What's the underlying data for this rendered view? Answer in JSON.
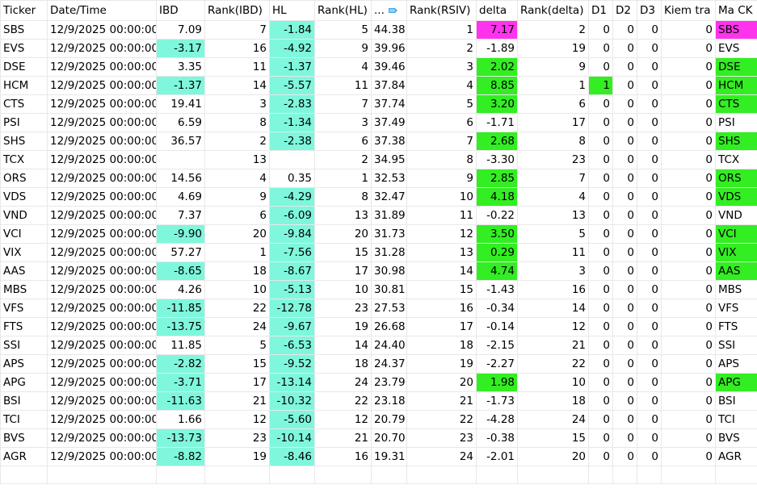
{
  "columns": [
    {
      "key": "ticker",
      "label": "Ticker",
      "align": "l"
    },
    {
      "key": "date",
      "label": "Date/Time",
      "align": "l"
    },
    {
      "key": "ibd",
      "label": "IBD",
      "align": "r"
    },
    {
      "key": "rank_ibd",
      "label": "Rank(IBD)",
      "align": "r"
    },
    {
      "key": "hl",
      "label": "HL",
      "align": "r"
    },
    {
      "key": "rank_hl",
      "label": "Rank(HL)",
      "align": "l"
    },
    {
      "key": "rsiv",
      "label": "...",
      "align": "l",
      "icon": "sort-descending-icon"
    },
    {
      "key": "rank_rsiv",
      "label": "Rank(RSIV)",
      "align": "l"
    },
    {
      "key": "delta",
      "label": "delta",
      "align": "l"
    },
    {
      "key": "rank_delta",
      "label": "Rank(delta)",
      "align": "l"
    },
    {
      "key": "d1",
      "label": "D1",
      "align": "l"
    },
    {
      "key": "d2",
      "label": "D2",
      "align": "l"
    },
    {
      "key": "d3",
      "label": "D3",
      "align": "l"
    },
    {
      "key": "kiem",
      "label": "Kiem tra",
      "align": "l"
    },
    {
      "key": "mack",
      "label": "Ma CK",
      "align": "l"
    }
  ],
  "colors": {
    "cyan": "#7ff7dc",
    "green": "#33ee22",
    "magenta": "#ff33ee"
  },
  "rows": [
    {
      "ticker": "SBS",
      "date": "12/9/2025 00:00:00",
      "ibd": "7.09",
      "rank_ibd": "7",
      "hl": "-1.84",
      "rank_hl": "5",
      "rsiv": "44.38",
      "rank_rsiv": "1",
      "delta": "7.17",
      "rank_delta": "2",
      "d1": "0",
      "d2": "0",
      "d3": "0",
      "kiem": "0",
      "mack": "SBS",
      "ibd_c": "",
      "hl_c": "cyan",
      "delta_c": "magenta",
      "d1_c": "",
      "mack_c": "magenta"
    },
    {
      "ticker": "EVS",
      "date": "12/9/2025 00:00:00",
      "ibd": "-3.17",
      "rank_ibd": "16",
      "hl": "-4.92",
      "rank_hl": "9",
      "rsiv": "39.96",
      "rank_rsiv": "2",
      "delta": "-1.89",
      "rank_delta": "19",
      "d1": "0",
      "d2": "0",
      "d3": "0",
      "kiem": "0",
      "mack": "EVS",
      "ibd_c": "cyan",
      "hl_c": "cyan",
      "delta_c": "",
      "d1_c": "",
      "mack_c": ""
    },
    {
      "ticker": "DSE",
      "date": "12/9/2025 00:00:00",
      "ibd": "3.35",
      "rank_ibd": "11",
      "hl": "-1.37",
      "rank_hl": "4",
      "rsiv": "39.46",
      "rank_rsiv": "3",
      "delta": "2.02",
      "rank_delta": "9",
      "d1": "0",
      "d2": "0",
      "d3": "0",
      "kiem": "0",
      "mack": "DSE",
      "ibd_c": "",
      "hl_c": "cyan",
      "delta_c": "green",
      "d1_c": "",
      "mack_c": "green"
    },
    {
      "ticker": "HCM",
      "date": "12/9/2025 00:00:00",
      "ibd": "-1.37",
      "rank_ibd": "14",
      "hl": "-5.57",
      "rank_hl": "11",
      "rsiv": "37.84",
      "rank_rsiv": "4",
      "delta": "8.85",
      "rank_delta": "1",
      "d1": "1",
      "d2": "0",
      "d3": "0",
      "kiem": "0",
      "mack": "HCM",
      "ibd_c": "cyan",
      "hl_c": "cyan",
      "delta_c": "green",
      "d1_c": "green",
      "mack_c": "green"
    },
    {
      "ticker": "CTS",
      "date": "12/9/2025 00:00:00",
      "ibd": "19.41",
      "rank_ibd": "3",
      "hl": "-2.83",
      "rank_hl": "7",
      "rsiv": "37.74",
      "rank_rsiv": "5",
      "delta": "3.20",
      "rank_delta": "6",
      "d1": "0",
      "d2": "0",
      "d3": "0",
      "kiem": "0",
      "mack": "CTS",
      "ibd_c": "",
      "hl_c": "cyan",
      "delta_c": "green",
      "d1_c": "",
      "mack_c": "green"
    },
    {
      "ticker": "PSI",
      "date": "12/9/2025 00:00:00",
      "ibd": "6.59",
      "rank_ibd": "8",
      "hl": "-1.34",
      "rank_hl": "3",
      "rsiv": "37.49",
      "rank_rsiv": "6",
      "delta": "-1.71",
      "rank_delta": "17",
      "d1": "0",
      "d2": "0",
      "d3": "0",
      "kiem": "0",
      "mack": "PSI",
      "ibd_c": "",
      "hl_c": "cyan",
      "delta_c": "",
      "d1_c": "",
      "mack_c": ""
    },
    {
      "ticker": "SHS",
      "date": "12/9/2025 00:00:00",
      "ibd": "36.57",
      "rank_ibd": "2",
      "hl": "-2.38",
      "rank_hl": "6",
      "rsiv": "37.38",
      "rank_rsiv": "7",
      "delta": "2.68",
      "rank_delta": "8",
      "d1": "0",
      "d2": "0",
      "d3": "0",
      "kiem": "0",
      "mack": "SHS",
      "ibd_c": "",
      "hl_c": "cyan",
      "delta_c": "green",
      "d1_c": "",
      "mack_c": "green"
    },
    {
      "ticker": "TCX",
      "date": "12/9/2025 00:00:00",
      "ibd": "",
      "rank_ibd": "13",
      "hl": "",
      "rank_hl": "2",
      "rsiv": "34.95",
      "rank_rsiv": "8",
      "delta": "-3.30",
      "rank_delta": "23",
      "d1": "0",
      "d2": "0",
      "d3": "0",
      "kiem": "0",
      "mack": "TCX",
      "ibd_c": "",
      "hl_c": "",
      "delta_c": "",
      "d1_c": "",
      "mack_c": ""
    },
    {
      "ticker": "ORS",
      "date": "12/9/2025 00:00:00",
      "ibd": "14.56",
      "rank_ibd": "4",
      "hl": "0.35",
      "rank_hl": "1",
      "rsiv": "32.53",
      "rank_rsiv": "9",
      "delta": "2.85",
      "rank_delta": "7",
      "d1": "0",
      "d2": "0",
      "d3": "0",
      "kiem": "0",
      "mack": "ORS",
      "ibd_c": "",
      "hl_c": "",
      "delta_c": "green",
      "d1_c": "",
      "mack_c": "green"
    },
    {
      "ticker": "VDS",
      "date": "12/9/2025 00:00:00",
      "ibd": "4.69",
      "rank_ibd": "9",
      "hl": "-4.29",
      "rank_hl": "8",
      "rsiv": "32.47",
      "rank_rsiv": "10",
      "delta": "4.18",
      "rank_delta": "4",
      "d1": "0",
      "d2": "0",
      "d3": "0",
      "kiem": "0",
      "mack": "VDS",
      "ibd_c": "",
      "hl_c": "cyan",
      "delta_c": "green",
      "d1_c": "",
      "mack_c": "green"
    },
    {
      "ticker": "VND",
      "date": "12/9/2025 00:00:00",
      "ibd": "7.37",
      "rank_ibd": "6",
      "hl": "-6.09",
      "rank_hl": "13",
      "rsiv": "31.89",
      "rank_rsiv": "11",
      "delta": "-0.22",
      "rank_delta": "13",
      "d1": "0",
      "d2": "0",
      "d3": "0",
      "kiem": "0",
      "mack": "VND",
      "ibd_c": "",
      "hl_c": "cyan",
      "delta_c": "",
      "d1_c": "",
      "mack_c": ""
    },
    {
      "ticker": "VCI",
      "date": "12/9/2025 00:00:00",
      "ibd": "-9.90",
      "rank_ibd": "20",
      "hl": "-9.84",
      "rank_hl": "20",
      "rsiv": "31.73",
      "rank_rsiv": "12",
      "delta": "3.50",
      "rank_delta": "5",
      "d1": "0",
      "d2": "0",
      "d3": "0",
      "kiem": "0",
      "mack": "VCI",
      "ibd_c": "cyan",
      "hl_c": "cyan",
      "delta_c": "green",
      "d1_c": "",
      "mack_c": "green"
    },
    {
      "ticker": "VIX",
      "date": "12/9/2025 00:00:00",
      "ibd": "57.27",
      "rank_ibd": "1",
      "hl": "-7.56",
      "rank_hl": "15",
      "rsiv": "31.28",
      "rank_rsiv": "13",
      "delta": "0.29",
      "rank_delta": "11",
      "d1": "0",
      "d2": "0",
      "d3": "0",
      "kiem": "0",
      "mack": "VIX",
      "ibd_c": "",
      "hl_c": "cyan",
      "delta_c": "green",
      "d1_c": "",
      "mack_c": "green"
    },
    {
      "ticker": "AAS",
      "date": "12/9/2025 00:00:00",
      "ibd": "-8.65",
      "rank_ibd": "18",
      "hl": "-8.67",
      "rank_hl": "17",
      "rsiv": "30.98",
      "rank_rsiv": "14",
      "delta": "4.74",
      "rank_delta": "3",
      "d1": "0",
      "d2": "0",
      "d3": "0",
      "kiem": "0",
      "mack": "AAS",
      "ibd_c": "cyan",
      "hl_c": "cyan",
      "delta_c": "green",
      "d1_c": "",
      "mack_c": "green"
    },
    {
      "ticker": "MBS",
      "date": "12/9/2025 00:00:00",
      "ibd": "4.26",
      "rank_ibd": "10",
      "hl": "-5.13",
      "rank_hl": "10",
      "rsiv": "30.81",
      "rank_rsiv": "15",
      "delta": "-1.43",
      "rank_delta": "16",
      "d1": "0",
      "d2": "0",
      "d3": "0",
      "kiem": "0",
      "mack": "MBS",
      "ibd_c": "",
      "hl_c": "cyan",
      "delta_c": "",
      "d1_c": "",
      "mack_c": ""
    },
    {
      "ticker": "VFS",
      "date": "12/9/2025 00:00:00",
      "ibd": "-11.85",
      "rank_ibd": "22",
      "hl": "-12.78",
      "rank_hl": "23",
      "rsiv": "27.53",
      "rank_rsiv": "16",
      "delta": "-0.34",
      "rank_delta": "14",
      "d1": "0",
      "d2": "0",
      "d3": "0",
      "kiem": "0",
      "mack": "VFS",
      "ibd_c": "cyan",
      "hl_c": "cyan",
      "delta_c": "",
      "d1_c": "",
      "mack_c": ""
    },
    {
      "ticker": "FTS",
      "date": "12/9/2025 00:00:00",
      "ibd": "-13.75",
      "rank_ibd": "24",
      "hl": "-9.67",
      "rank_hl": "19",
      "rsiv": "26.68",
      "rank_rsiv": "17",
      "delta": "-0.14",
      "rank_delta": "12",
      "d1": "0",
      "d2": "0",
      "d3": "0",
      "kiem": "0",
      "mack": "FTS",
      "ibd_c": "cyan",
      "hl_c": "cyan",
      "delta_c": "",
      "d1_c": "",
      "mack_c": ""
    },
    {
      "ticker": "SSI",
      "date": "12/9/2025 00:00:00",
      "ibd": "11.85",
      "rank_ibd": "5",
      "hl": "-6.53",
      "rank_hl": "14",
      "rsiv": "24.40",
      "rank_rsiv": "18",
      "delta": "-2.15",
      "rank_delta": "21",
      "d1": "0",
      "d2": "0",
      "d3": "0",
      "kiem": "0",
      "mack": "SSI",
      "ibd_c": "",
      "hl_c": "cyan",
      "delta_c": "",
      "d1_c": "",
      "mack_c": ""
    },
    {
      "ticker": "APS",
      "date": "12/9/2025 00:00:00",
      "ibd": "-2.82",
      "rank_ibd": "15",
      "hl": "-9.52",
      "rank_hl": "18",
      "rsiv": "24.37",
      "rank_rsiv": "19",
      "delta": "-2.27",
      "rank_delta": "22",
      "d1": "0",
      "d2": "0",
      "d3": "0",
      "kiem": "0",
      "mack": "APS",
      "ibd_c": "cyan",
      "hl_c": "cyan",
      "delta_c": "",
      "d1_c": "",
      "mack_c": ""
    },
    {
      "ticker": "APG",
      "date": "12/9/2025 00:00:00",
      "ibd": "-3.71",
      "rank_ibd": "17",
      "hl": "-13.14",
      "rank_hl": "24",
      "rsiv": "23.79",
      "rank_rsiv": "20",
      "delta": "1.98",
      "rank_delta": "10",
      "d1": "0",
      "d2": "0",
      "d3": "0",
      "kiem": "0",
      "mack": "APG",
      "ibd_c": "cyan",
      "hl_c": "cyan",
      "delta_c": "green",
      "d1_c": "",
      "mack_c": "green"
    },
    {
      "ticker": "BSI",
      "date": "12/9/2025 00:00:00",
      "ibd": "-11.63",
      "rank_ibd": "21",
      "hl": "-10.32",
      "rank_hl": "22",
      "rsiv": "23.18",
      "rank_rsiv": "21",
      "delta": "-1.73",
      "rank_delta": "18",
      "d1": "0",
      "d2": "0",
      "d3": "0",
      "kiem": "0",
      "mack": "BSI",
      "ibd_c": "cyan",
      "hl_c": "cyan",
      "delta_c": "",
      "d1_c": "",
      "mack_c": ""
    },
    {
      "ticker": "TCI",
      "date": "12/9/2025 00:00:00",
      "ibd": "1.66",
      "rank_ibd": "12",
      "hl": "-5.60",
      "rank_hl": "12",
      "rsiv": "20.79",
      "rank_rsiv": "22",
      "delta": "-4.28",
      "rank_delta": "24",
      "d1": "0",
      "d2": "0",
      "d3": "0",
      "kiem": "0",
      "mack": "TCI",
      "ibd_c": "",
      "hl_c": "cyan",
      "delta_c": "",
      "d1_c": "",
      "mack_c": ""
    },
    {
      "ticker": "BVS",
      "date": "12/9/2025 00:00:00",
      "ibd": "-13.73",
      "rank_ibd": "23",
      "hl": "-10.14",
      "rank_hl": "21",
      "rsiv": "20.70",
      "rank_rsiv": "23",
      "delta": "-0.38",
      "rank_delta": "15",
      "d1": "0",
      "d2": "0",
      "d3": "0",
      "kiem": "0",
      "mack": "BVS",
      "ibd_c": "cyan",
      "hl_c": "cyan",
      "delta_c": "",
      "d1_c": "",
      "mack_c": ""
    },
    {
      "ticker": "AGR",
      "date": "12/9/2025 00:00:00",
      "ibd": "-8.82",
      "rank_ibd": "19",
      "hl": "-8.46",
      "rank_hl": "16",
      "rsiv": "19.31",
      "rank_rsiv": "24",
      "delta": "-2.01",
      "rank_delta": "20",
      "d1": "0",
      "d2": "0",
      "d3": "0",
      "kiem": "0",
      "mack": "AGR",
      "ibd_c": "cyan",
      "hl_c": "cyan",
      "delta_c": "",
      "d1_c": "",
      "mack_c": ""
    }
  ]
}
